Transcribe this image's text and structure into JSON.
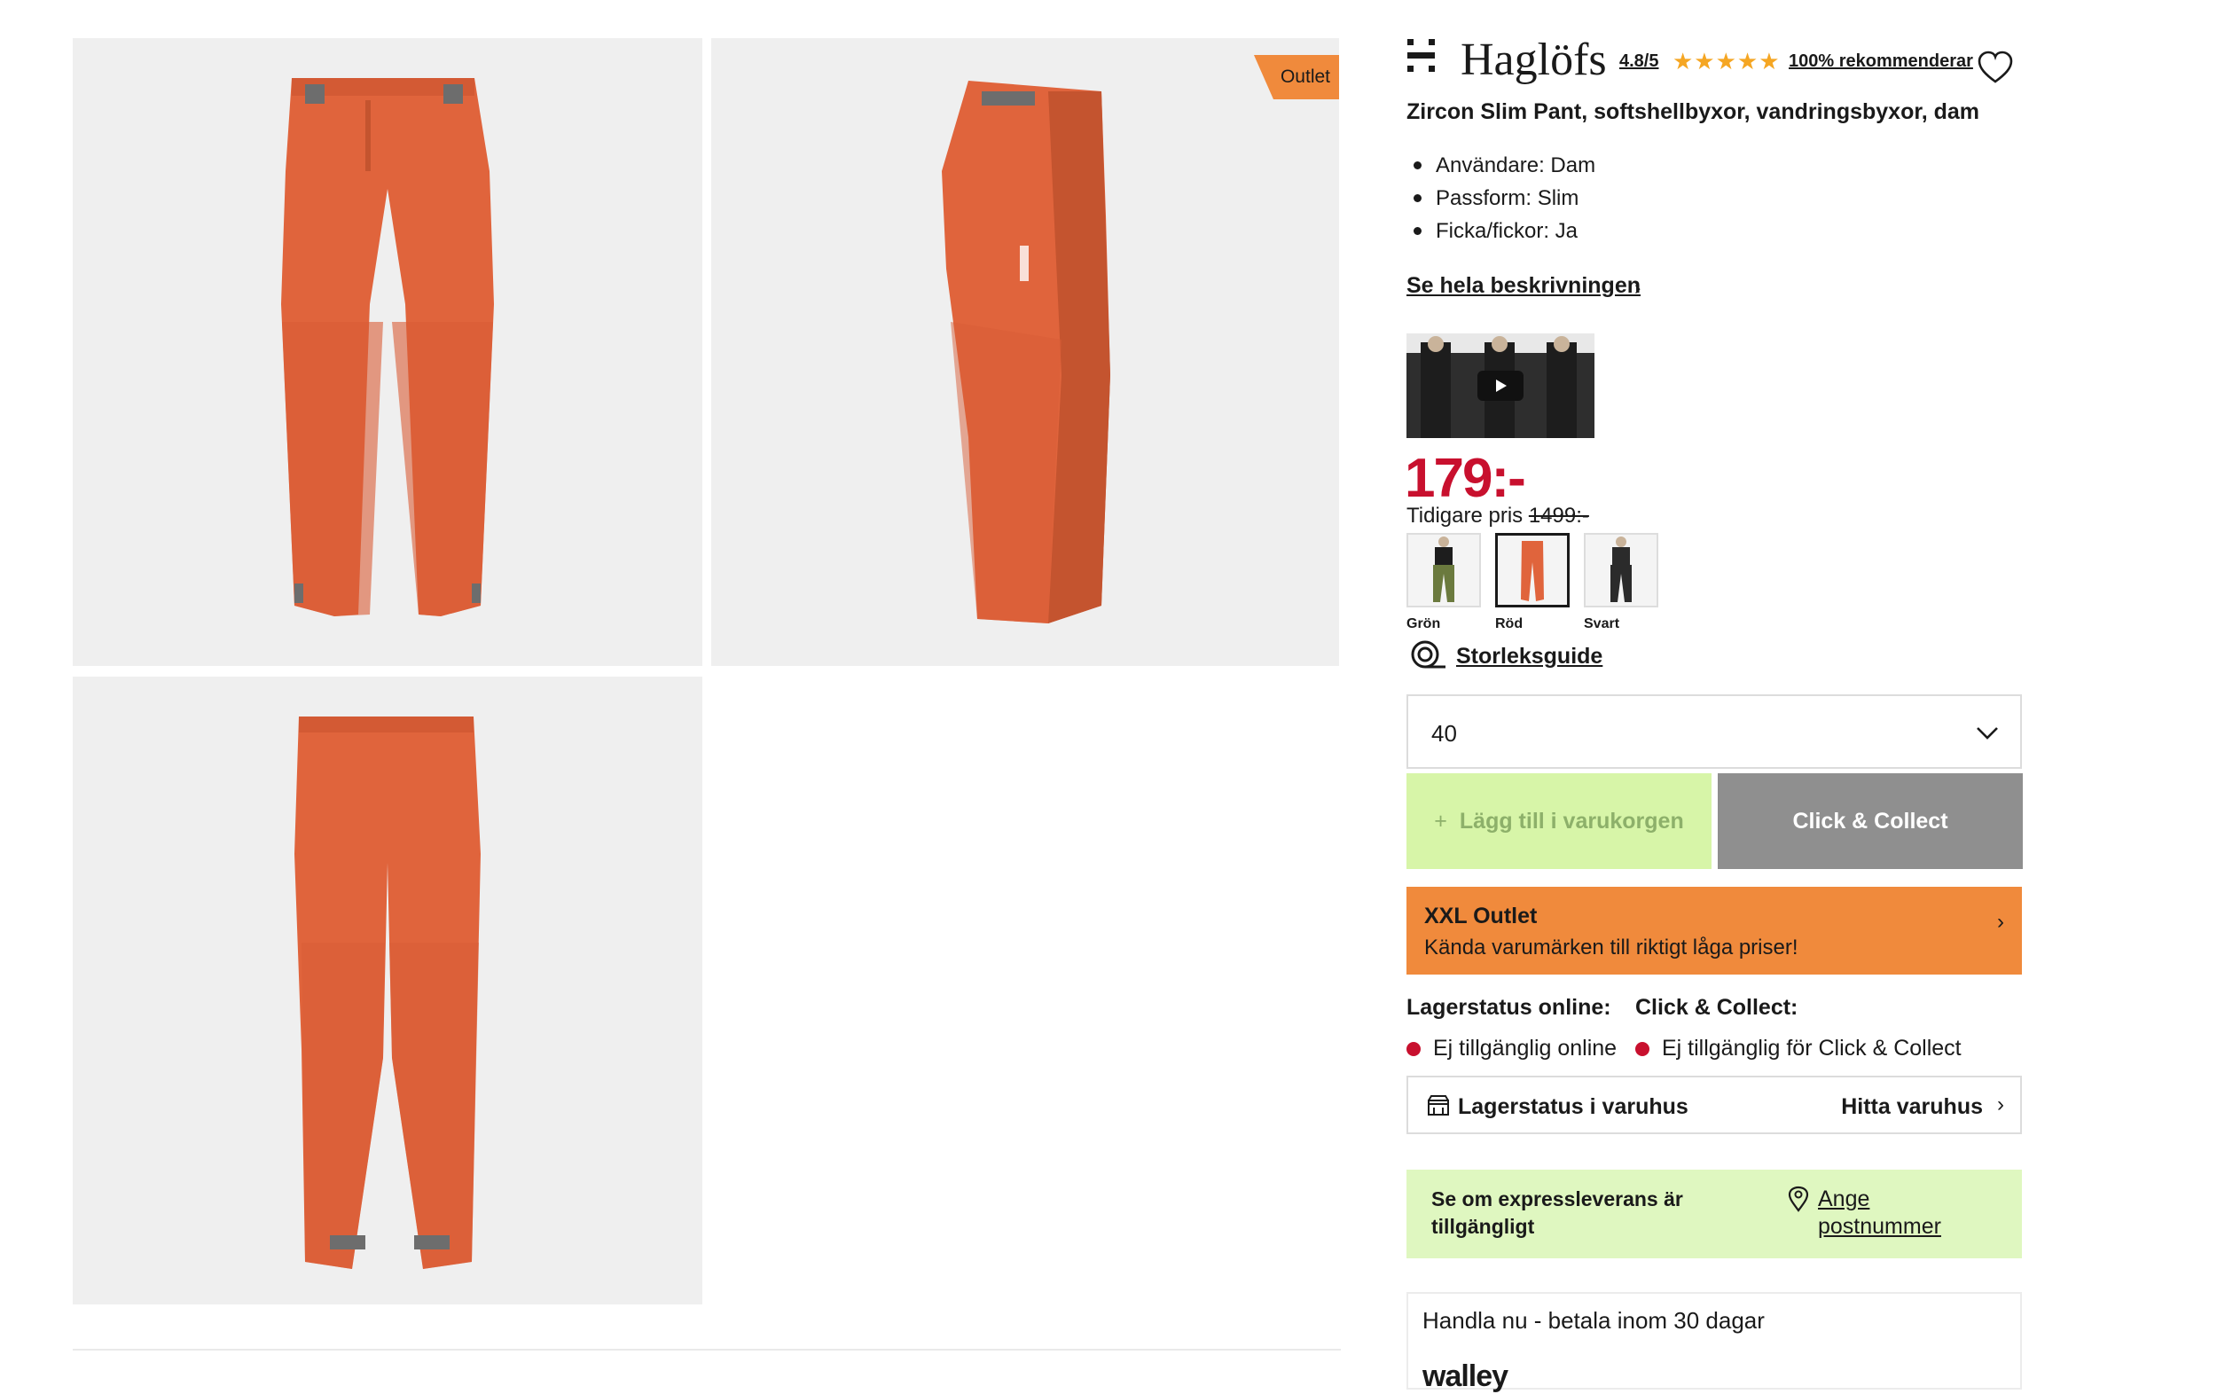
{
  "gallery": {
    "badge": "Outlet",
    "colors": {
      "tile_bg": "#efefef",
      "pants": "#e0643c",
      "pants_dark": "#c4542f",
      "strap": "#6d6d6d"
    }
  },
  "product": {
    "brand": "Haglöfs",
    "rating": "4.8/5",
    "stars": "★★★★★",
    "recommend": "100% rekommenderar",
    "title": "Zircon Slim Pant, softshellbyxor, vandringsbyxor, dam",
    "specs": [
      "Användare: Dam",
      "Passform: Slim",
      "Ficka/fickor: Ja"
    ],
    "description_link": "Se hela beskrivningen",
    "price": "179:-",
    "previous_price_label": "Tidigare pris",
    "previous_price": "1499:-",
    "swatches": [
      {
        "label": "Grön",
        "color": "#6b7a3e",
        "selected": false
      },
      {
        "label": "Röd",
        "color": "#e0643c",
        "selected": true
      },
      {
        "label": "Svart",
        "color": "#2b2b2b",
        "selected": false
      }
    ],
    "size_guide": "Storleksguide",
    "size_selected": "40"
  },
  "actions": {
    "add_to_cart": "Lägg till i varukorgen",
    "add_icon": "+",
    "click_collect": "Click & Collect"
  },
  "outlet_banner": {
    "title": "XXL Outlet",
    "subtitle": "Kända varumärken till riktigt låga priser!"
  },
  "stock": {
    "online_heading": "Lagerstatus online:",
    "cc_heading": "Click & Collect:",
    "online_status": "Ej tillgänglig online",
    "cc_status": "Ej tillgänglig för Click & Collect",
    "store_label": "Lagerstatus i varuhus",
    "find_store": "Hitta varuhus"
  },
  "express": {
    "text": "Se om expressleverans är tillgängligt",
    "link": "Ange postnummer"
  },
  "payment": {
    "text": "Handla nu - betala inom 30 dagar",
    "logo": "walley"
  },
  "colors": {
    "price_red": "#c8102e",
    "outlet_orange": "#f08a3c",
    "add_green": "#d7f5a8",
    "express_green": "#dff7c0",
    "star": "#f5a623"
  }
}
